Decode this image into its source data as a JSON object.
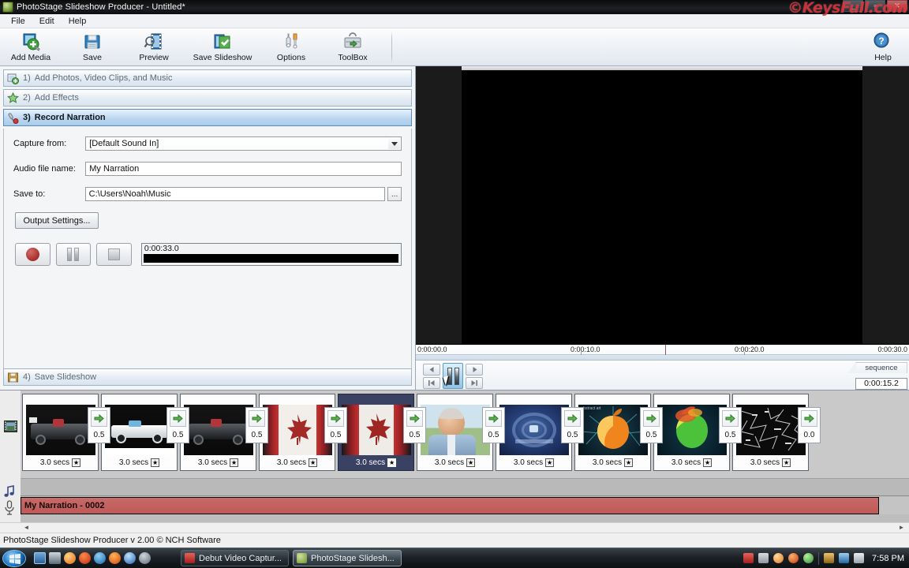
{
  "window": {
    "title": "PhotoStage Slideshow Producer - Untitled*",
    "icon": "app-icon",
    "buttons": {
      "minimize": "_",
      "maximize": "▫",
      "close": "✕"
    },
    "watermark": "©KeysFull.com"
  },
  "menubar": {
    "items": [
      "File",
      "Edit",
      "Help"
    ]
  },
  "toolbar": {
    "buttons": [
      {
        "label": "Add Media",
        "icon": "add-media-icon"
      },
      {
        "label": "Save",
        "icon": "floppy-disk-icon"
      },
      {
        "label": "Preview",
        "icon": "preview-film-icon"
      },
      {
        "label": "Save Slideshow",
        "icon": "save-slideshow-icon"
      },
      {
        "label": "Options",
        "icon": "wrench-screwdriver-icon"
      },
      {
        "label": "ToolBox",
        "icon": "toolbox-icon"
      }
    ],
    "help": {
      "label": "Help",
      "icon": "help-question-icon"
    }
  },
  "steps": [
    {
      "num": "1)",
      "label": "Add Photos, Video Clips, and Music",
      "icon": "add-photos-icon",
      "active": false
    },
    {
      "num": "2)",
      "label": "Add Effects",
      "icon": "star-icon",
      "active": false
    },
    {
      "num": "3)",
      "label": "Record Narration",
      "icon": "microphone-icon",
      "active": true
    },
    {
      "num": "4)",
      "label": "Save Slideshow",
      "icon": "floppy-disk-icon",
      "active": false
    }
  ],
  "narration_panel": {
    "capture_from_label": "Capture from:",
    "capture_from_value": "[Default Sound In]",
    "capture_from_options": [
      "[Default Sound In]"
    ],
    "audio_file_name_label": "Audio file name:",
    "audio_file_name_value": "My Narration",
    "save_to_label": "Save to:",
    "save_to_value": "C:\\Users\\Noah\\Music",
    "browse_label": "...",
    "output_settings_label": "Output Settings...",
    "record_icon": "record-circle-icon",
    "pause_icon": "pause-icon",
    "stop_icon": "stop-icon",
    "elapsed_time": "0:00:33.0"
  },
  "preview": {
    "ruler_ticks": [
      "0:00:00.0",
      "0:00:10.0",
      "0:00:20.0",
      "0:00:30.0"
    ],
    "transport": {
      "step_back_icon": "step-back-icon",
      "step_forward_icon": "step-forward-icon",
      "jump_start_icon": "jump-to-start-icon",
      "jump_end_icon": "jump-to-end-icon",
      "pause_icon": "pause-icon"
    },
    "sequence_tab": "sequence",
    "timecode": "0:00:15.2"
  },
  "filmstrip": {
    "track_icon": "filmstrip-icon",
    "slides": [
      {
        "duration": "3.0 secs",
        "star": "★",
        "selected": false,
        "thumb": "race-car-dark"
      },
      {
        "duration": "3.0 secs",
        "star": "★",
        "selected": false,
        "thumb": "race-car-white"
      },
      {
        "duration": "3.0 secs",
        "star": "★",
        "selected": false,
        "thumb": "race-car-dark-2"
      },
      {
        "duration": "3.0 secs",
        "star": "★",
        "selected": false,
        "thumb": "canada-flag"
      },
      {
        "duration": "3.0 secs",
        "star": "★",
        "selected": true,
        "thumb": "canada-flag-2"
      },
      {
        "duration": "3.0 secs",
        "star": "★",
        "selected": false,
        "thumb": "man-portrait"
      },
      {
        "duration": "3.0 secs",
        "star": "★",
        "selected": false,
        "thumb": "blue-swirl"
      },
      {
        "duration": "3.0 secs",
        "star": "★",
        "selected": false,
        "thumb": "orange-apple"
      },
      {
        "duration": "3.0 secs",
        "star": "★",
        "selected": false,
        "thumb": "green-apple"
      },
      {
        "duration": "3.0 secs",
        "star": "★",
        "selected": false,
        "thumb": "black-white-abstract"
      }
    ],
    "transitions": [
      "0.5",
      "0.5",
      "0.5",
      "0.5",
      "0.5",
      "0.5",
      "0.5",
      "0.5",
      "0.5",
      "0.0"
    ],
    "transition_icon": "green-arrow-icon"
  },
  "tracks": {
    "music_icon": "music-note-icon",
    "narration_icon": "microphone-icon",
    "narration_clip_label": "My Narration - 0002",
    "scroll_left_icon": "scroll-left-arrow",
    "scroll_right_icon": "scroll-right-arrow"
  },
  "statusbar": {
    "text": "PhotoStage Slideshow Producer v 2.00 © NCH Software"
  },
  "taskbar": {
    "start_icon": "windows-start-orb",
    "quick_launch": [
      "show-desktop-icon",
      "switch-window-icon",
      "media-player-icon",
      "firefox-flame-icon",
      "internet-explorer-icon",
      "firefox-icon",
      "itunes-icon",
      "chrome-icon"
    ],
    "tasks": [
      {
        "label": "Debut Video Captur...",
        "icon": "debut-icon",
        "active": false
      },
      {
        "label": "PhotoStage Slidesh...",
        "icon": "photostage-icon",
        "active": true
      }
    ],
    "tray": [
      "debut-tray-icon",
      "wave-tray-icon",
      "orange-tray-icon",
      "flame-tray-icon",
      "shield-tray-icon",
      "signal-tray-icon",
      "network-tray-icon",
      "volume-tray-icon"
    ],
    "clock": "7:58 PM"
  },
  "colors": {
    "accent": "#a9cbe9",
    "narration_clip": "#c05a58",
    "selected_slide": "#3a4263",
    "watermark": "#e2242e"
  }
}
